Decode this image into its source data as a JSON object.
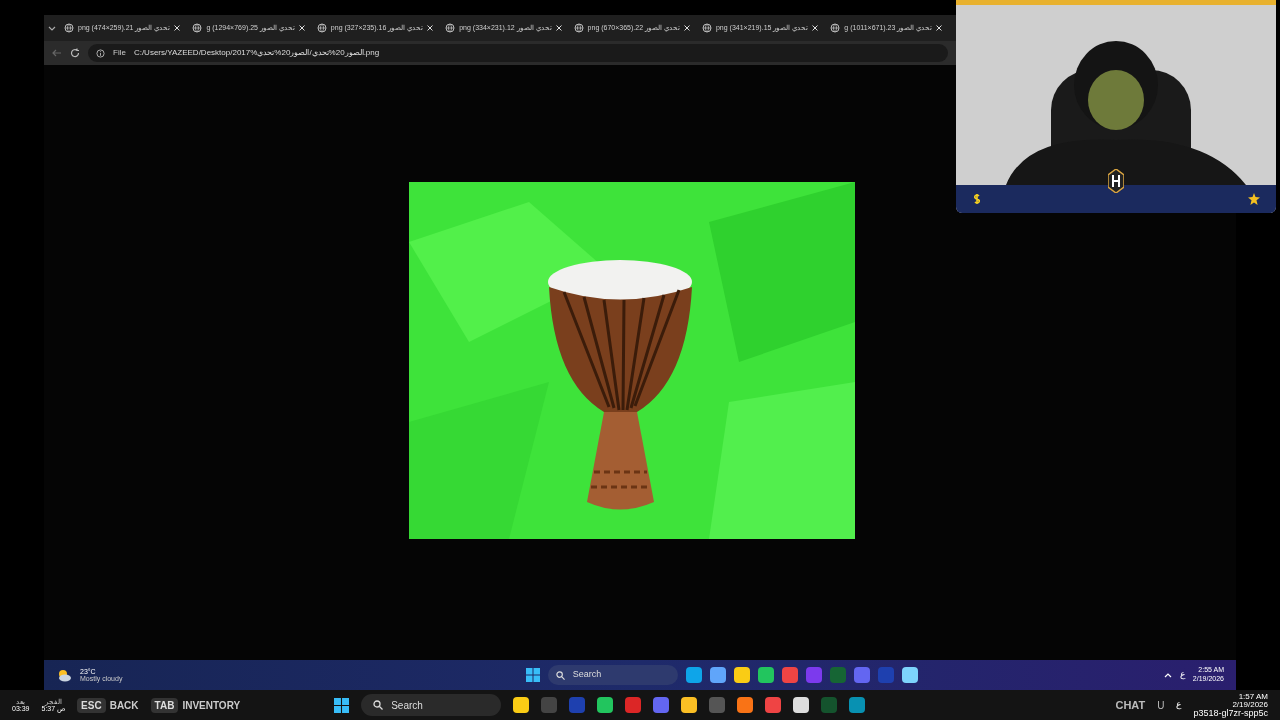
{
  "browser": {
    "tabs": [
      {
        "title": "g (1011×671).23 تحدي الصور",
        "selected": false
      },
      {
        "title": "png (341×219).15 تحدي الصور",
        "selected": false
      },
      {
        "title": "png (670×365).22 تحدي الصور",
        "selected": false
      },
      {
        "title": "png (334×231).12 تحدي الصور",
        "selected": false
      },
      {
        "title": "png (327×235).16 تحدي الصور",
        "selected": false
      },
      {
        "title": "g (1294×769).25 تحدي الصور",
        "selected": false
      },
      {
        "title": "png (474×259).21 تحدي الصور",
        "selected": false
      }
    ],
    "address": {
      "scheme": "File",
      "url": "C:/Users/YAZEED/Desktop/2017%الصور20%تحدي/الصور20%تحدي.png"
    }
  },
  "inner_taskbar": {
    "temperature": "23°C",
    "weather": "Mostly cloudy",
    "search": "Search",
    "language": "ع",
    "time": "2:55 AM",
    "date": "2/19/2026"
  },
  "game_hint": {
    "keys": [
      {
        "key": "TAB",
        "action": "INVENTORY"
      },
      {
        "key": "ESC",
        "action": "BACK"
      }
    ]
  },
  "prayer": [
    {
      "name": "الفجر",
      "time": "5:37 ص"
    },
    {
      "name": "بعد",
      "time": "03:39"
    }
  ],
  "taskbar": {
    "search": "Search",
    "chat": "CHAT",
    "user": "U",
    "language": "ع",
    "time": "1:57 AM",
    "date": "2/19/2026",
    "host": "p3518-gl7zr-spp5c"
  }
}
